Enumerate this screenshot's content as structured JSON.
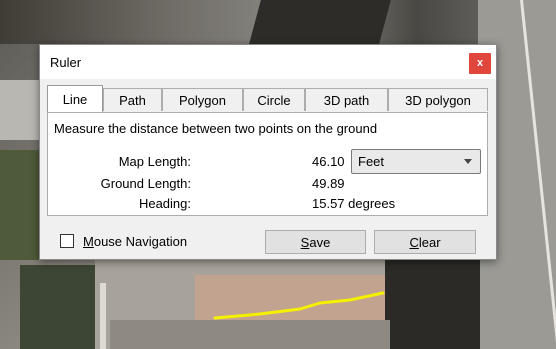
{
  "window": {
    "title": "Ruler",
    "close_label": "x"
  },
  "tabs": [
    {
      "label": "Line",
      "active": true
    },
    {
      "label": "Path",
      "active": false
    },
    {
      "label": "Polygon",
      "active": false
    },
    {
      "label": "Circle",
      "active": false
    },
    {
      "label": "3D path",
      "active": false
    },
    {
      "label": "3D polygon",
      "active": false
    }
  ],
  "panel": {
    "description": "Measure the distance between two points on the ground",
    "map_length_label": "Map Length:",
    "map_length_value": "46.10",
    "unit_selected": "Feet",
    "ground_length_label": "Ground Length:",
    "ground_length_value": "49.89",
    "heading_label": "Heading:",
    "heading_value": "15.57 degrees"
  },
  "footer": {
    "mouse_nav_label": "Mouse Navigation",
    "mouse_nav_checked": false,
    "save_label": "Save",
    "clear_label": "Clear"
  },
  "colors": {
    "close_button": "#e0463b",
    "measure_line": "#f4f000"
  },
  "icons": {
    "close": "close-icon",
    "dropdown": "chevron-down-icon"
  }
}
